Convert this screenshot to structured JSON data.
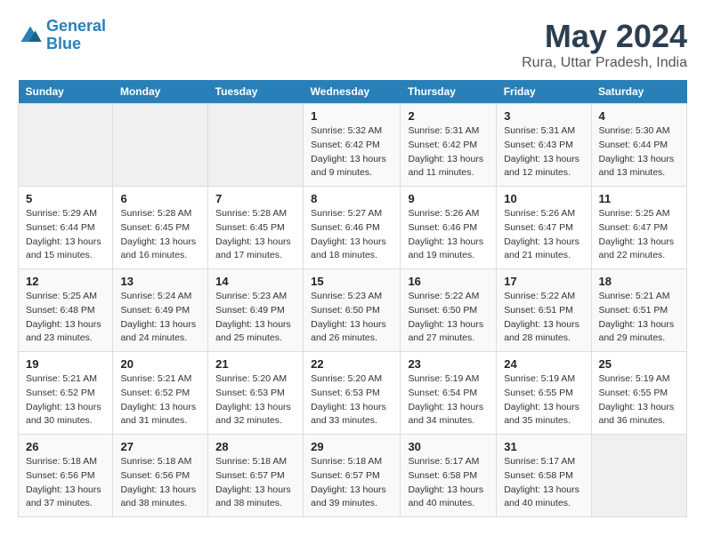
{
  "logo": {
    "line1": "General",
    "line2": "Blue"
  },
  "title": "May 2024",
  "subtitle": "Rura, Uttar Pradesh, India",
  "weekdays": [
    "Sunday",
    "Monday",
    "Tuesday",
    "Wednesday",
    "Thursday",
    "Friday",
    "Saturday"
  ],
  "weeks": [
    [
      {
        "day": "",
        "sunrise": "",
        "sunset": "",
        "daylight": ""
      },
      {
        "day": "",
        "sunrise": "",
        "sunset": "",
        "daylight": ""
      },
      {
        "day": "",
        "sunrise": "",
        "sunset": "",
        "daylight": ""
      },
      {
        "day": "1",
        "sunrise": "Sunrise: 5:32 AM",
        "sunset": "Sunset: 6:42 PM",
        "daylight": "Daylight: 13 hours and 9 minutes."
      },
      {
        "day": "2",
        "sunrise": "Sunrise: 5:31 AM",
        "sunset": "Sunset: 6:42 PM",
        "daylight": "Daylight: 13 hours and 11 minutes."
      },
      {
        "day": "3",
        "sunrise": "Sunrise: 5:31 AM",
        "sunset": "Sunset: 6:43 PM",
        "daylight": "Daylight: 13 hours and 12 minutes."
      },
      {
        "day": "4",
        "sunrise": "Sunrise: 5:30 AM",
        "sunset": "Sunset: 6:44 PM",
        "daylight": "Daylight: 13 hours and 13 minutes."
      }
    ],
    [
      {
        "day": "5",
        "sunrise": "Sunrise: 5:29 AM",
        "sunset": "Sunset: 6:44 PM",
        "daylight": "Daylight: 13 hours and 15 minutes."
      },
      {
        "day": "6",
        "sunrise": "Sunrise: 5:28 AM",
        "sunset": "Sunset: 6:45 PM",
        "daylight": "Daylight: 13 hours and 16 minutes."
      },
      {
        "day": "7",
        "sunrise": "Sunrise: 5:28 AM",
        "sunset": "Sunset: 6:45 PM",
        "daylight": "Daylight: 13 hours and 17 minutes."
      },
      {
        "day": "8",
        "sunrise": "Sunrise: 5:27 AM",
        "sunset": "Sunset: 6:46 PM",
        "daylight": "Daylight: 13 hours and 18 minutes."
      },
      {
        "day": "9",
        "sunrise": "Sunrise: 5:26 AM",
        "sunset": "Sunset: 6:46 PM",
        "daylight": "Daylight: 13 hours and 19 minutes."
      },
      {
        "day": "10",
        "sunrise": "Sunrise: 5:26 AM",
        "sunset": "Sunset: 6:47 PM",
        "daylight": "Daylight: 13 hours and 21 minutes."
      },
      {
        "day": "11",
        "sunrise": "Sunrise: 5:25 AM",
        "sunset": "Sunset: 6:47 PM",
        "daylight": "Daylight: 13 hours and 22 minutes."
      }
    ],
    [
      {
        "day": "12",
        "sunrise": "Sunrise: 5:25 AM",
        "sunset": "Sunset: 6:48 PM",
        "daylight": "Daylight: 13 hours and 23 minutes."
      },
      {
        "day": "13",
        "sunrise": "Sunrise: 5:24 AM",
        "sunset": "Sunset: 6:49 PM",
        "daylight": "Daylight: 13 hours and 24 minutes."
      },
      {
        "day": "14",
        "sunrise": "Sunrise: 5:23 AM",
        "sunset": "Sunset: 6:49 PM",
        "daylight": "Daylight: 13 hours and 25 minutes."
      },
      {
        "day": "15",
        "sunrise": "Sunrise: 5:23 AM",
        "sunset": "Sunset: 6:50 PM",
        "daylight": "Daylight: 13 hours and 26 minutes."
      },
      {
        "day": "16",
        "sunrise": "Sunrise: 5:22 AM",
        "sunset": "Sunset: 6:50 PM",
        "daylight": "Daylight: 13 hours and 27 minutes."
      },
      {
        "day": "17",
        "sunrise": "Sunrise: 5:22 AM",
        "sunset": "Sunset: 6:51 PM",
        "daylight": "Daylight: 13 hours and 28 minutes."
      },
      {
        "day": "18",
        "sunrise": "Sunrise: 5:21 AM",
        "sunset": "Sunset: 6:51 PM",
        "daylight": "Daylight: 13 hours and 29 minutes."
      }
    ],
    [
      {
        "day": "19",
        "sunrise": "Sunrise: 5:21 AM",
        "sunset": "Sunset: 6:52 PM",
        "daylight": "Daylight: 13 hours and 30 minutes."
      },
      {
        "day": "20",
        "sunrise": "Sunrise: 5:21 AM",
        "sunset": "Sunset: 6:52 PM",
        "daylight": "Daylight: 13 hours and 31 minutes."
      },
      {
        "day": "21",
        "sunrise": "Sunrise: 5:20 AM",
        "sunset": "Sunset: 6:53 PM",
        "daylight": "Daylight: 13 hours and 32 minutes."
      },
      {
        "day": "22",
        "sunrise": "Sunrise: 5:20 AM",
        "sunset": "Sunset: 6:53 PM",
        "daylight": "Daylight: 13 hours and 33 minutes."
      },
      {
        "day": "23",
        "sunrise": "Sunrise: 5:19 AM",
        "sunset": "Sunset: 6:54 PM",
        "daylight": "Daylight: 13 hours and 34 minutes."
      },
      {
        "day": "24",
        "sunrise": "Sunrise: 5:19 AM",
        "sunset": "Sunset: 6:55 PM",
        "daylight": "Daylight: 13 hours and 35 minutes."
      },
      {
        "day": "25",
        "sunrise": "Sunrise: 5:19 AM",
        "sunset": "Sunset: 6:55 PM",
        "daylight": "Daylight: 13 hours and 36 minutes."
      }
    ],
    [
      {
        "day": "26",
        "sunrise": "Sunrise: 5:18 AM",
        "sunset": "Sunset: 6:56 PM",
        "daylight": "Daylight: 13 hours and 37 minutes."
      },
      {
        "day": "27",
        "sunrise": "Sunrise: 5:18 AM",
        "sunset": "Sunset: 6:56 PM",
        "daylight": "Daylight: 13 hours and 38 minutes."
      },
      {
        "day": "28",
        "sunrise": "Sunrise: 5:18 AM",
        "sunset": "Sunset: 6:57 PM",
        "daylight": "Daylight: 13 hours and 38 minutes."
      },
      {
        "day": "29",
        "sunrise": "Sunrise: 5:18 AM",
        "sunset": "Sunset: 6:57 PM",
        "daylight": "Daylight: 13 hours and 39 minutes."
      },
      {
        "day": "30",
        "sunrise": "Sunrise: 5:17 AM",
        "sunset": "Sunset: 6:58 PM",
        "daylight": "Daylight: 13 hours and 40 minutes."
      },
      {
        "day": "31",
        "sunrise": "Sunrise: 5:17 AM",
        "sunset": "Sunset: 6:58 PM",
        "daylight": "Daylight: 13 hours and 40 minutes."
      },
      {
        "day": "",
        "sunrise": "",
        "sunset": "",
        "daylight": ""
      }
    ]
  ]
}
